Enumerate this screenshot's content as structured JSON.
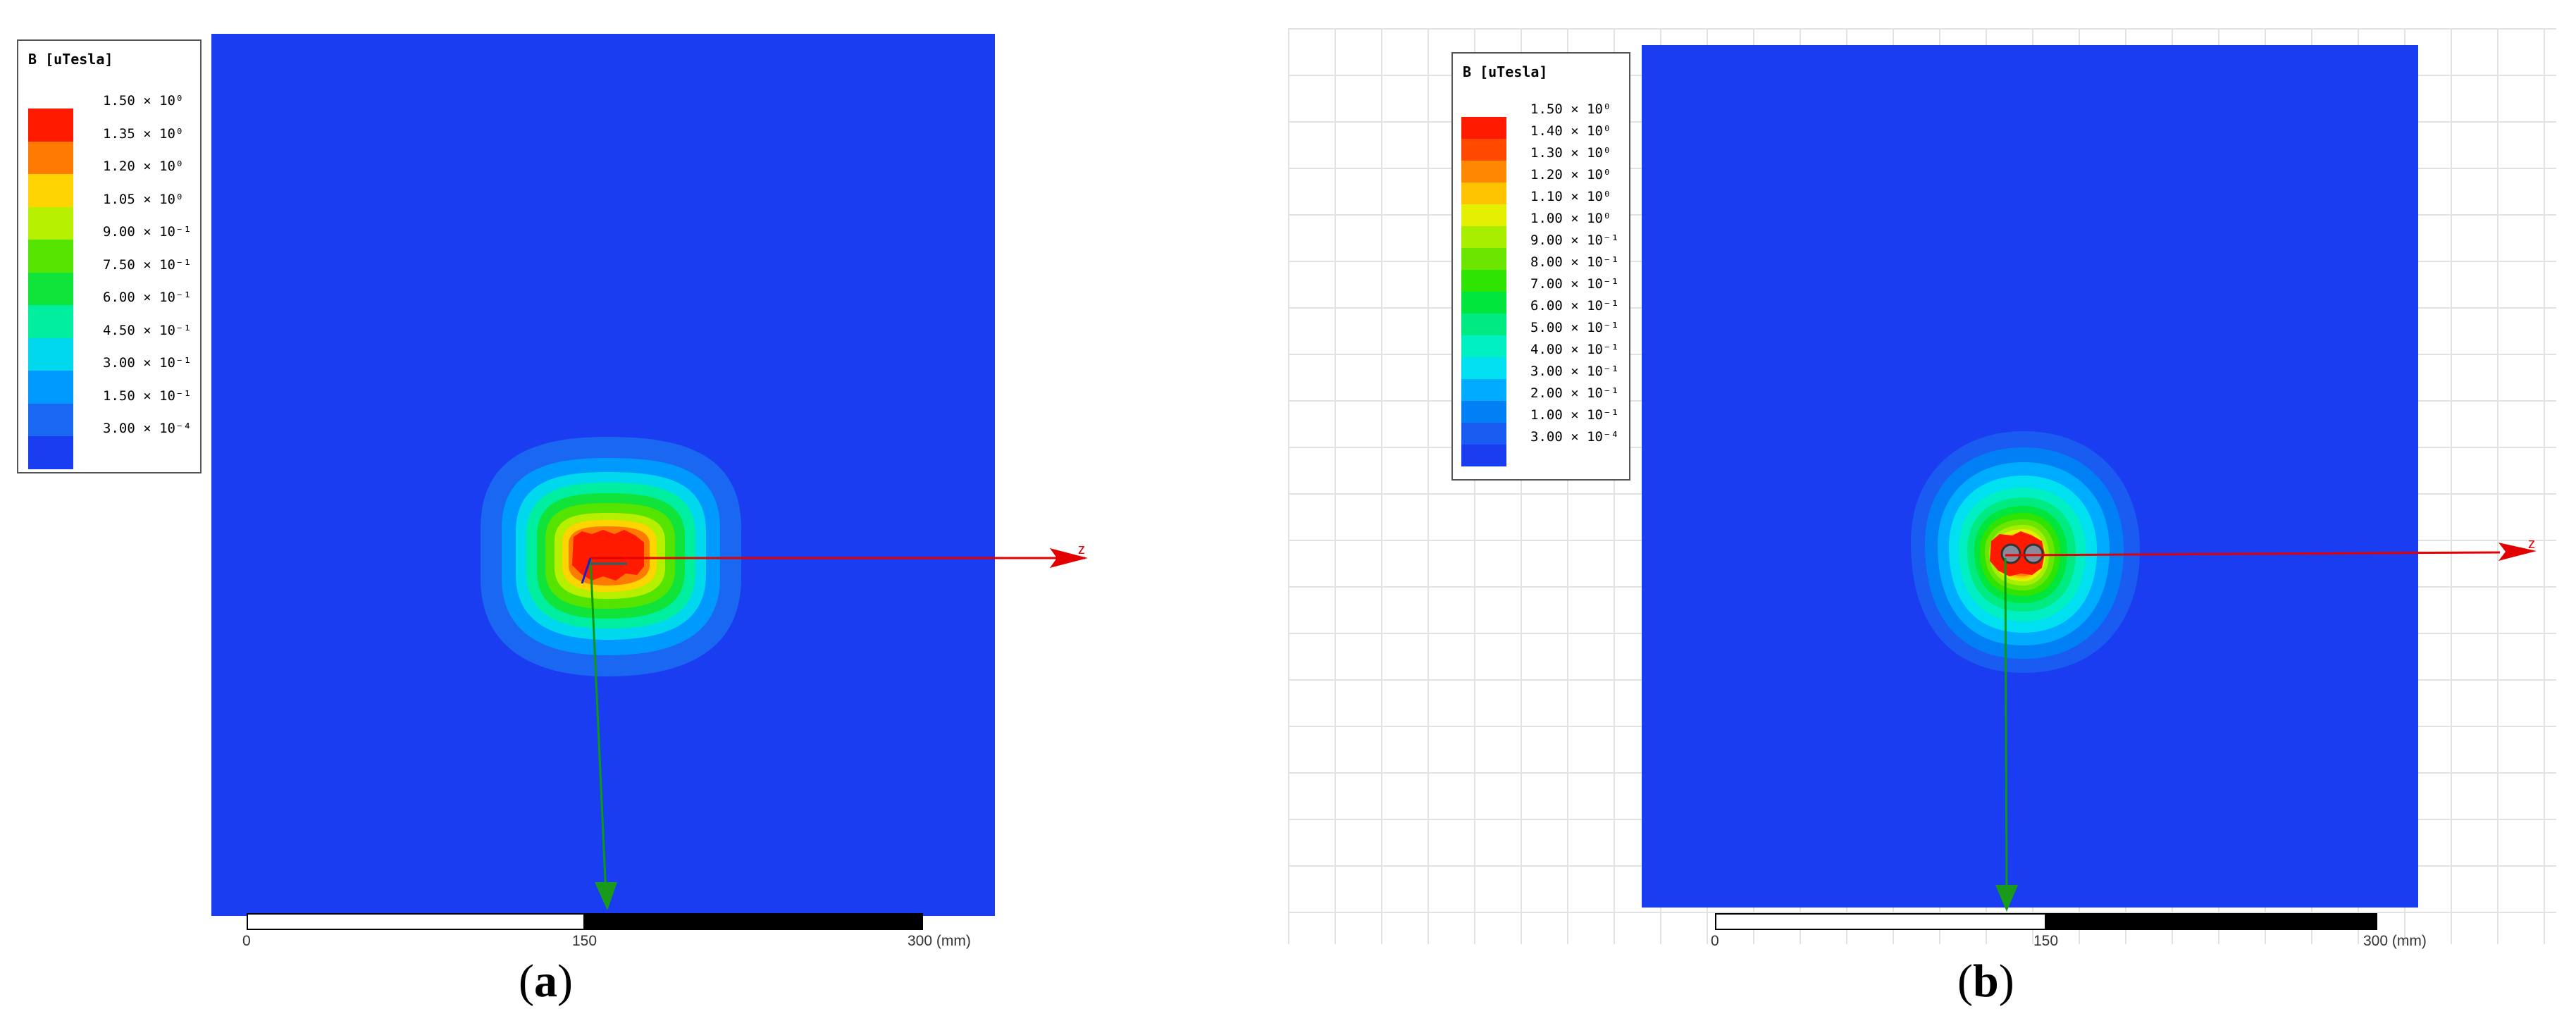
{
  "panels": [
    {
      "id": "a",
      "legend_title": "B [uTesla]",
      "legend": [
        {
          "label": "1.50 × 10⁰",
          "color": "#ff1a00"
        },
        {
          "label": "1.35 × 10⁰",
          "color": "#ff7a00"
        },
        {
          "label": "1.20 × 10⁰",
          "color": "#ffd400"
        },
        {
          "label": "1.05 × 10⁰",
          "color": "#b6ef00"
        },
        {
          "label": "9.00 × 10⁻¹",
          "color": "#55e400"
        },
        {
          "label": "7.50 × 10⁻¹",
          "color": "#10e43a"
        },
        {
          "label": "6.00 × 10⁻¹",
          "color": "#00eea0"
        },
        {
          "label": "4.50 × 10⁻¹",
          "color": "#00d8ee"
        },
        {
          "label": "3.00 × 10⁻¹",
          "color": "#009aff"
        },
        {
          "label": "1.50 × 10⁻¹",
          "color": "#1a68f2"
        },
        {
          "label": "3.00 × 10⁻⁴",
          "color": "#1a3df2"
        }
      ],
      "axis_label": "z",
      "scale": {
        "start": "0",
        "mid": "150",
        "end": "300 (mm)"
      },
      "caption": "a"
    },
    {
      "id": "b",
      "legend_title": "B [uTesla]",
      "legend": [
        {
          "label": "1.50 × 10⁰",
          "color": "#ff1a00"
        },
        {
          "label": "1.40 × 10⁰",
          "color": "#ff4a00"
        },
        {
          "label": "1.30 × 10⁰",
          "color": "#ff8800"
        },
        {
          "label": "1.20 × 10⁰",
          "color": "#ffc400"
        },
        {
          "label": "1.10 × 10⁰",
          "color": "#e4f000"
        },
        {
          "label": "1.00 × 10⁰",
          "color": "#a8ee00"
        },
        {
          "label": "9.00 × 10⁻¹",
          "color": "#6ce600"
        },
        {
          "label": "8.00 × 10⁻¹",
          "color": "#2ee400"
        },
        {
          "label": "7.00 × 10⁻¹",
          "color": "#00e63c"
        },
        {
          "label": "6.00 × 10⁻¹",
          "color": "#00ea82"
        },
        {
          "label": "5.00 × 10⁻¹",
          "color": "#00f0c4"
        },
        {
          "label": "4.00 × 10⁻¹",
          "color": "#00e0f0"
        },
        {
          "label": "3.00 × 10⁻¹",
          "color": "#00acff"
        },
        {
          "label": "2.00 × 10⁻¹",
          "color": "#0080f4"
        },
        {
          "label": "1.00 × 10⁻¹",
          "color": "#1a5cf2"
        },
        {
          "label": "3.00 × 10⁻⁴",
          "color": "#1a3df2"
        }
      ],
      "axis_label": "z",
      "scale": {
        "start": "0",
        "mid": "150",
        "end": "300 (mm)"
      },
      "caption": "b"
    }
  ]
}
